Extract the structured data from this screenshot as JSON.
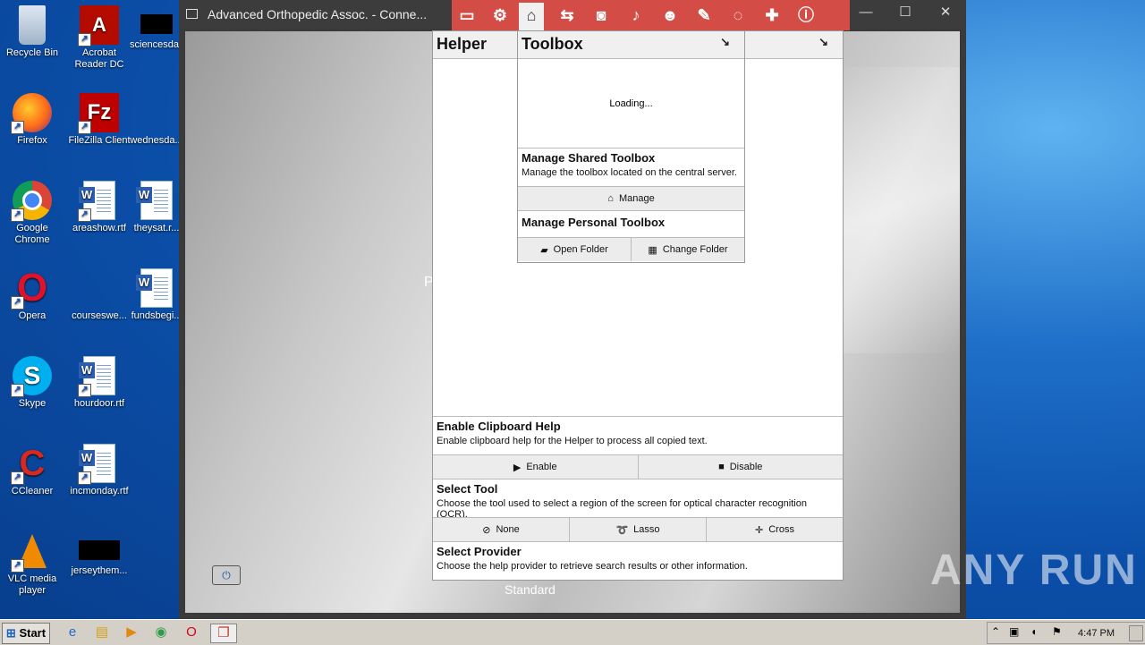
{
  "desktop": {
    "icons": [
      {
        "label": "Recycle Bin"
      },
      {
        "label": "Acrobat Reader DC"
      },
      {
        "label": "sciencesda..."
      },
      {
        "label": "Firefox"
      },
      {
        "label": "FileZilla Client"
      },
      {
        "label": "wednesda..."
      },
      {
        "label": "Google Chrome"
      },
      {
        "label": "areashow.rtf"
      },
      {
        "label": "theysat.r..."
      },
      {
        "label": "Opera"
      },
      {
        "label": "courseswe..."
      },
      {
        "label": "fundsbegi..."
      },
      {
        "label": "Skype"
      },
      {
        "label": "hourdoor.rtf"
      },
      {
        "label": "CCleaner"
      },
      {
        "label": "incmonday.rtf"
      },
      {
        "label": "VLC media player"
      },
      {
        "label": "jerseythem..."
      }
    ]
  },
  "window": {
    "title": "Advanced Orthopedic Assoc. - Conne...",
    "remote_partial_text": "P",
    "remote_logo_text": "Standard"
  },
  "toolbar": {
    "icons": [
      "monitor-icon",
      "gear-icon",
      "toolbox-icon",
      "swap-icon",
      "camera-icon",
      "microphone-icon",
      "users-icon",
      "pencil-icon",
      "chat-icon",
      "plus-icon",
      "info-icon"
    ]
  },
  "helper": {
    "title": "Helper",
    "clipboard": {
      "title": "Enable Clipboard Help",
      "desc": "Enable clipboard help for the Helper to process all copied text.",
      "enable_label": "Enable",
      "disable_label": "Disable"
    },
    "select_tool": {
      "title": "Select Tool",
      "desc": "Choose the tool used to select a region of the screen for optical character recognition (OCR).",
      "none_label": "None",
      "lasso_label": "Lasso",
      "cross_label": "Cross"
    },
    "select_provider": {
      "title": "Select Provider",
      "desc": "Choose the help provider to retrieve search results or other information."
    }
  },
  "toolbox": {
    "title": "Toolbox",
    "loading": "Loading...",
    "shared": {
      "title": "Manage Shared Toolbox",
      "desc": "Manage the toolbox located on the central server.",
      "manage_label": "Manage"
    },
    "personal": {
      "title": "Manage Personal Toolbox",
      "open_label": "Open Folder",
      "change_label": "Change Folder"
    }
  },
  "taskbar": {
    "start_label": "Start",
    "clock": "4:47 PM"
  },
  "watermark": "ANY RUN"
}
